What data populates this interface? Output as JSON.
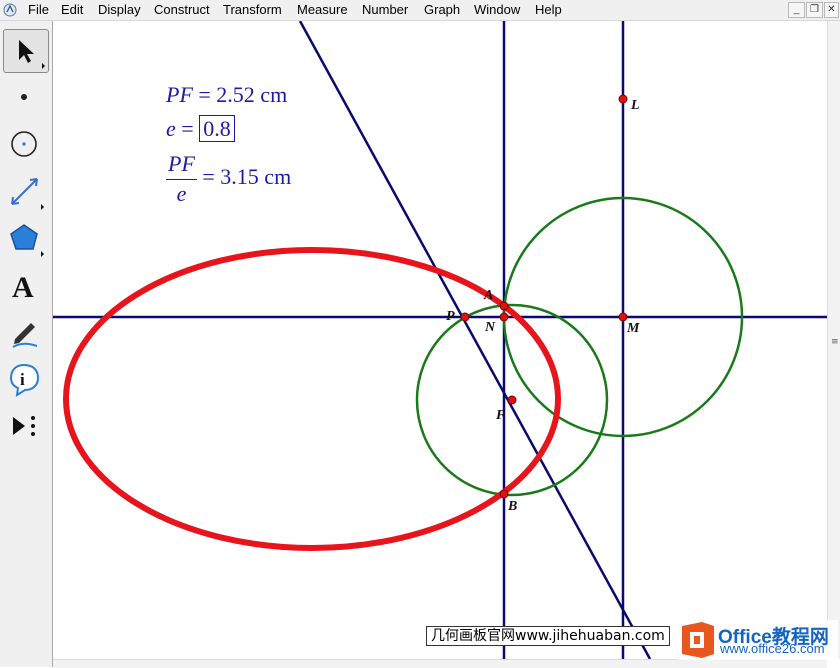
{
  "menubar": {
    "items": [
      "File",
      "Edit",
      "Display",
      "Construct",
      "Transform",
      "Measure",
      "Number",
      "Graph",
      "Window",
      "Help"
    ]
  },
  "toolbox": {
    "tools": [
      "arrow-select-tool",
      "point-tool",
      "compass-tool",
      "straightedge-tool",
      "polygon-tool",
      "text-tool",
      "marker-tool",
      "information-tool",
      "custom-tool"
    ]
  },
  "measurements": {
    "pf_name": "PF",
    "pf_value": "= 2.52 cm",
    "e_name": "e",
    "e_eq": "=",
    "e_value": "0.8",
    "ratio_num": "PF",
    "ratio_den": "e",
    "ratio_value": "= 3.15 cm"
  },
  "points": {
    "L": "L",
    "A": "A",
    "P": "P",
    "N": "N",
    "M": "M",
    "F": "F",
    "B": "B"
  },
  "colors": {
    "line": "#0a0a6e",
    "circle": "#1a7a1a",
    "locus": "#e8141c",
    "point": "#e01010",
    "measure_text": "#1a1aa6"
  },
  "watermark": {
    "text": "几何画板官网www.jihehuaban.com",
    "logo_text": "Office教程网",
    "logo_url": "www.office26.com"
  }
}
